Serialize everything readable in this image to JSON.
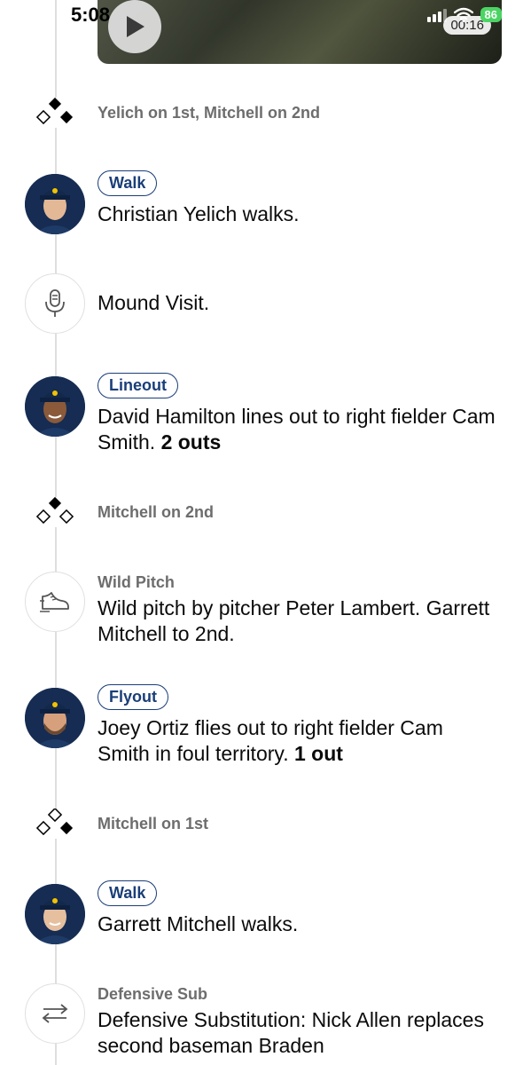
{
  "status_bar": {
    "time": "5:08",
    "battery": "86"
  },
  "video": {
    "duration": "00:16"
  },
  "events": {
    "e1": {
      "runners": "Yelich on 1st, Mitchell on 2nd"
    },
    "e2": {
      "badge": "Walk",
      "description": "Christian Yelich walks."
    },
    "e3": {
      "description": "Mound Visit."
    },
    "e4": {
      "badge": "Lineout",
      "description": "David Hamilton lines out to right fielder Cam Smith.",
      "outs": "2 outs"
    },
    "e5": {
      "runners": "Mitchell on 2nd"
    },
    "e6": {
      "title": "Wild Pitch",
      "description": "Wild pitch by pitcher Peter Lambert. Garrett Mitchell to 2nd."
    },
    "e7": {
      "badge": "Flyout",
      "description": "Joey Ortiz flies out to right fielder Cam Smith in foul territory.",
      "outs": "1 out"
    },
    "e8": {
      "runners": "Mitchell on 1st"
    },
    "e9": {
      "badge": "Walk",
      "description": "Garrett Mitchell walks."
    },
    "e10": {
      "title": "Defensive Sub",
      "description": "Defensive Substitution: Nick Allen replaces second baseman Braden"
    }
  },
  "icons": {
    "play": "play-icon",
    "mound_visit": "microphone-icon",
    "wild_pitch": "shoe-icon",
    "defensive_sub": "swap-arrows-icon",
    "bases": "base-diamond-icon",
    "player": "player-avatar"
  },
  "colors": {
    "badge": "#1a3e78",
    "battery": "#4bd463",
    "avatar_bg": "#162c52",
    "muted_text": "#6d6d6d"
  }
}
